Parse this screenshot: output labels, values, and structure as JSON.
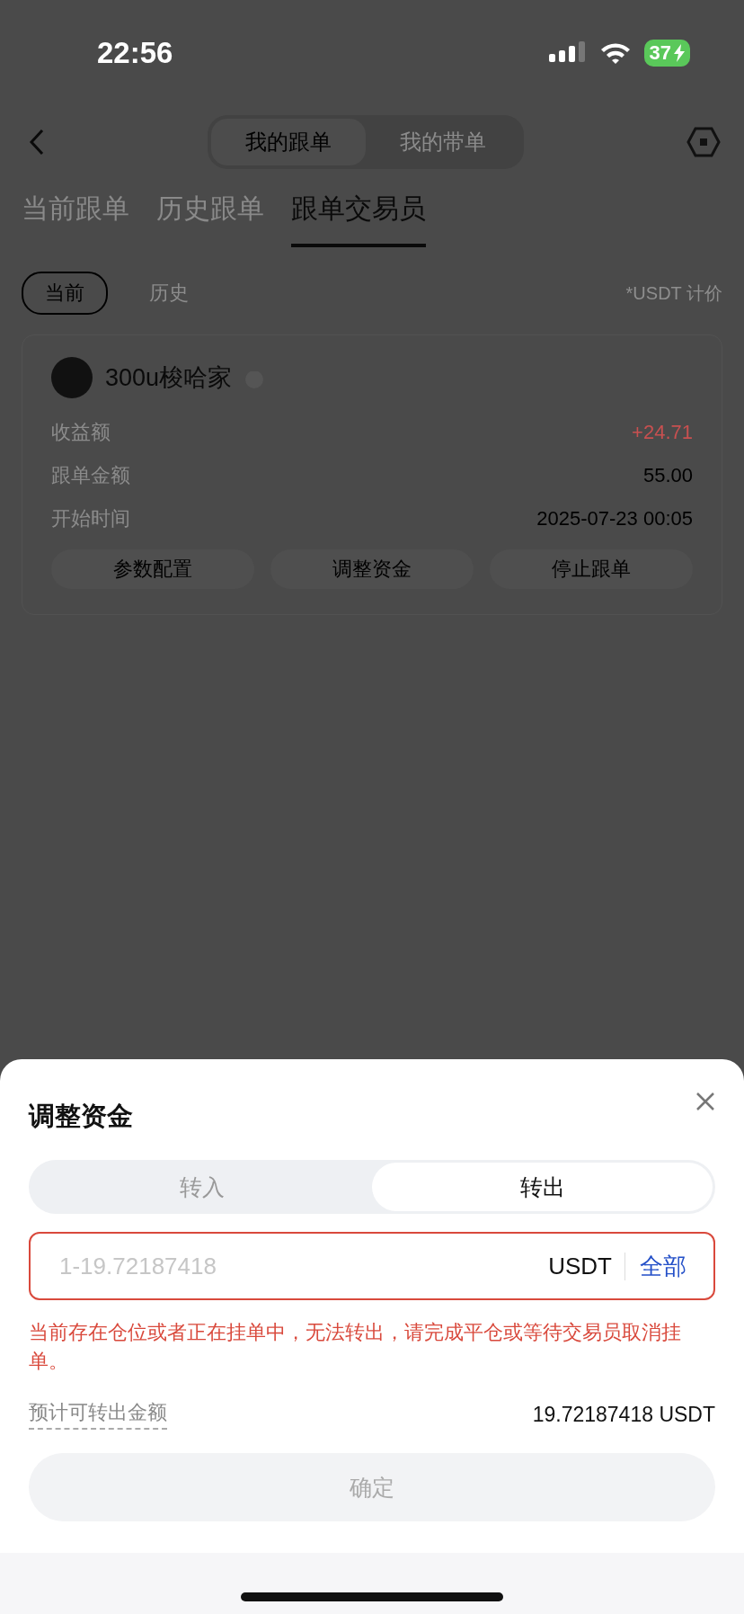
{
  "status_bar": {
    "time": "22:56",
    "battery": "37"
  },
  "nav": {
    "segments": [
      {
        "label": "我的跟单",
        "selected": true
      },
      {
        "label": "我的带单",
        "selected": false
      }
    ]
  },
  "tabs": [
    {
      "label": "当前跟单",
      "selected": false
    },
    {
      "label": "历史跟单",
      "selected": false
    },
    {
      "label": "跟单交易员",
      "selected": true
    }
  ],
  "filters": [
    {
      "label": "当前",
      "selected": true
    },
    {
      "label": "历史",
      "selected": false
    }
  ],
  "unit_note": "*USDT 计价",
  "card": {
    "name": "300u梭哈家",
    "rows": [
      {
        "label": "收益额",
        "value": "+24.71",
        "kind": "profit"
      },
      {
        "label": "跟单金额",
        "value": "55.00",
        "kind": "plain"
      },
      {
        "label": "开始时间",
        "value": "2025-07-23 00:05",
        "kind": "plain"
      }
    ],
    "actions": [
      "参数配置",
      "调整资金",
      "停止跟单"
    ]
  },
  "sheet": {
    "title": "调整资金",
    "segments": [
      {
        "label": "转入",
        "selected": false
      },
      {
        "label": "转出",
        "selected": true
      }
    ],
    "amount_field": {
      "placeholder": "1-19.72187418",
      "unit": "USDT",
      "all_label": "全部",
      "error": true
    },
    "error_message": "当前存在仓位或者正在挂单中，无法转出，请完成平仓或等待交易员取消挂单。",
    "estimate": {
      "label": "预计可转出金额",
      "value": "19.72187418 USDT"
    },
    "confirm": {
      "label": "确定",
      "disabled": true
    }
  }
}
